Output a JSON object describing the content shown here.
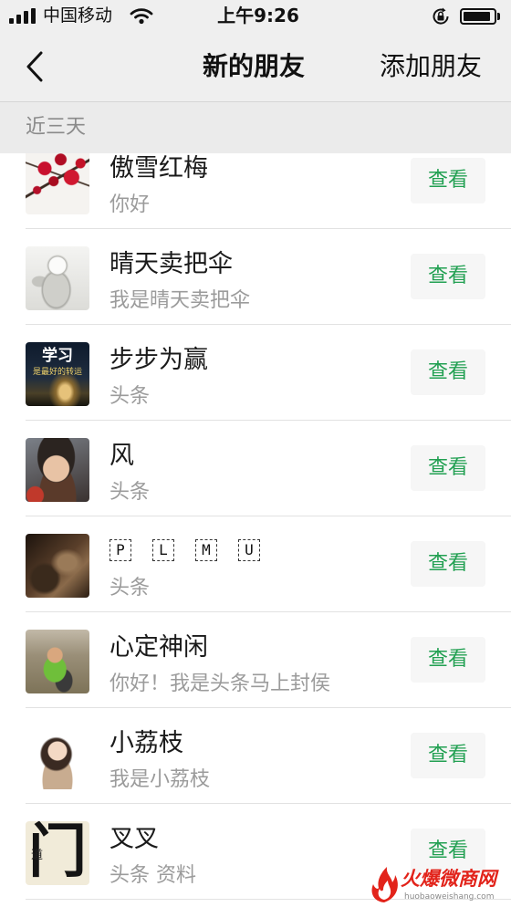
{
  "status_bar": {
    "carrier": "中国移动",
    "time": "上午9:26",
    "signal_bars": 4,
    "signal_bars_max": 4,
    "battery_level": 0.9
  },
  "nav": {
    "title": "新的朋友",
    "action_label": "添加朋友"
  },
  "section": {
    "label": "近三天"
  },
  "friends": [
    {
      "name": "傲雪红梅",
      "message": "你好",
      "button_label": "查看"
    },
    {
      "name": "晴天卖把伞",
      "message": "我是晴天卖把伞",
      "button_label": "查看"
    },
    {
      "name": "步步为赢",
      "message": "头条",
      "button_label": "查看",
      "avatar_text": [
        "学习",
        "是最好的转运"
      ]
    },
    {
      "name": "风",
      "message": "头条",
      "button_label": "查看"
    },
    {
      "name_letters": [
        "P",
        "L",
        "M",
        "U"
      ],
      "message": "头条",
      "button_label": "查看"
    },
    {
      "name": "心定神闲",
      "message": "你好！我是头条马上封侯",
      "button_label": "查看"
    },
    {
      "name": "小荔枝",
      "message": "我是小荔枝",
      "button_label": "查看"
    },
    {
      "name": "叉叉",
      "message": "头条 资料",
      "button_label": "查看",
      "avatar_text": [
        "门",
        "道"
      ]
    }
  ],
  "watermark": {
    "brand": "火爆微商网",
    "url": "huobaoweishang.com"
  },
  "colors": {
    "accent_green": "#22a052",
    "nav_bg": "#efefef",
    "section_bg": "#ebebeb",
    "watermark_red": "#e2231a"
  },
  "icons": {
    "signal": "signal-icon",
    "wifi": "wifi-icon",
    "orientation_lock": "orientation-lock-icon",
    "battery": "battery-icon",
    "back": "back-chevron-icon",
    "watermark_logo": "flame-logo-icon"
  }
}
